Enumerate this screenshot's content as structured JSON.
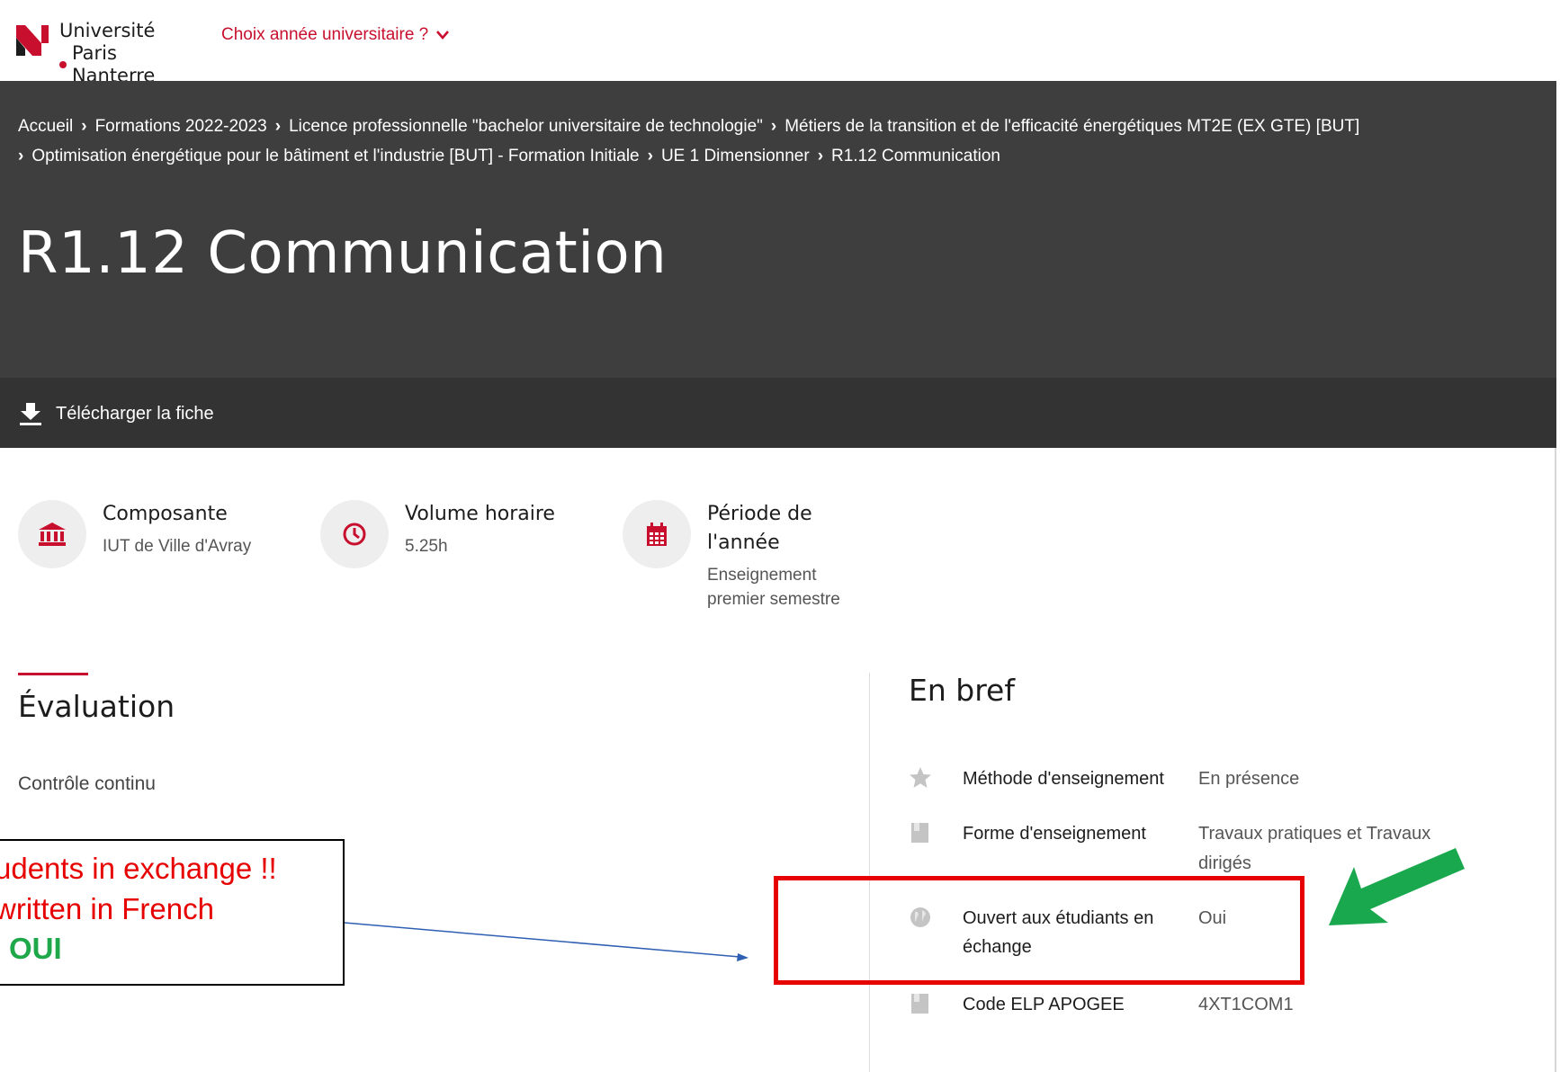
{
  "header": {
    "logo_line1": "Université",
    "logo_line2": "Paris Nanterre",
    "year_choice": "Choix année universitaire ?",
    "year_choice_icon": "chevron-down-icon"
  },
  "breadcrumb": {
    "separator": ">",
    "items": [
      "Accueil",
      "Formations 2022-2023",
      "Licence professionnelle \"bachelor universitaire de technologie\"",
      "Métiers de la transition et de l'efficacité énergétiques MT2E (EX GTE) [BUT]",
      "Optimisation énergétique pour le bâtiment et l'industrie [BUT] - Formation Initiale",
      "UE 1 Dimensionner",
      "R1.12 Communication"
    ]
  },
  "page_title": "R1.12 Communication",
  "download_label": "Télécharger la fiche",
  "info": {
    "composante": {
      "label": "Composante",
      "value": "IUT de Ville d'Avray",
      "icon": "building-icon"
    },
    "volume": {
      "label": "Volume horaire",
      "value": "5.25h",
      "icon": "clock-icon"
    },
    "periode": {
      "label_line1": "Période de",
      "label_line2": "l'année",
      "value_line1": "Enseignement",
      "value_line2": "premier semestre",
      "icon": "calendar-icon"
    }
  },
  "evaluation": {
    "title": "Évaluation",
    "text": "Contrôle continu"
  },
  "en_bref": {
    "title": "En bref",
    "rows": [
      {
        "label": "Méthode d'enseignement",
        "value": "En présence",
        "icon": "star-icon"
      },
      {
        "label": "Forme d'enseignement",
        "value_line1": "Travaux pratiques et Travaux",
        "value_line2": "dirigés",
        "icon": "book-icon"
      },
      {
        "label_line1": "Ouvert aux étudiants en",
        "label_line2": "échange",
        "value": "Oui",
        "icon": "globe-icon"
      },
      {
        "label": "Code ELP APOGEE",
        "value": "4XT1COM1",
        "icon": "book-icon"
      }
    ]
  },
  "annotation": {
    "line1": "udents in exchange !!",
    "line2": "written in French",
    "line3": "OUI",
    "colors": {
      "text_red": "#e60000",
      "text_green": "#1ea84a",
      "frame": "#e60000",
      "arrow_blue": "#2f5fb3",
      "arrow_green": "#1aa84e"
    }
  },
  "colors": {
    "brand_red": "#c8102e",
    "hero_bg": "#3e3e3e",
    "download_bar_bg": "#333333"
  }
}
